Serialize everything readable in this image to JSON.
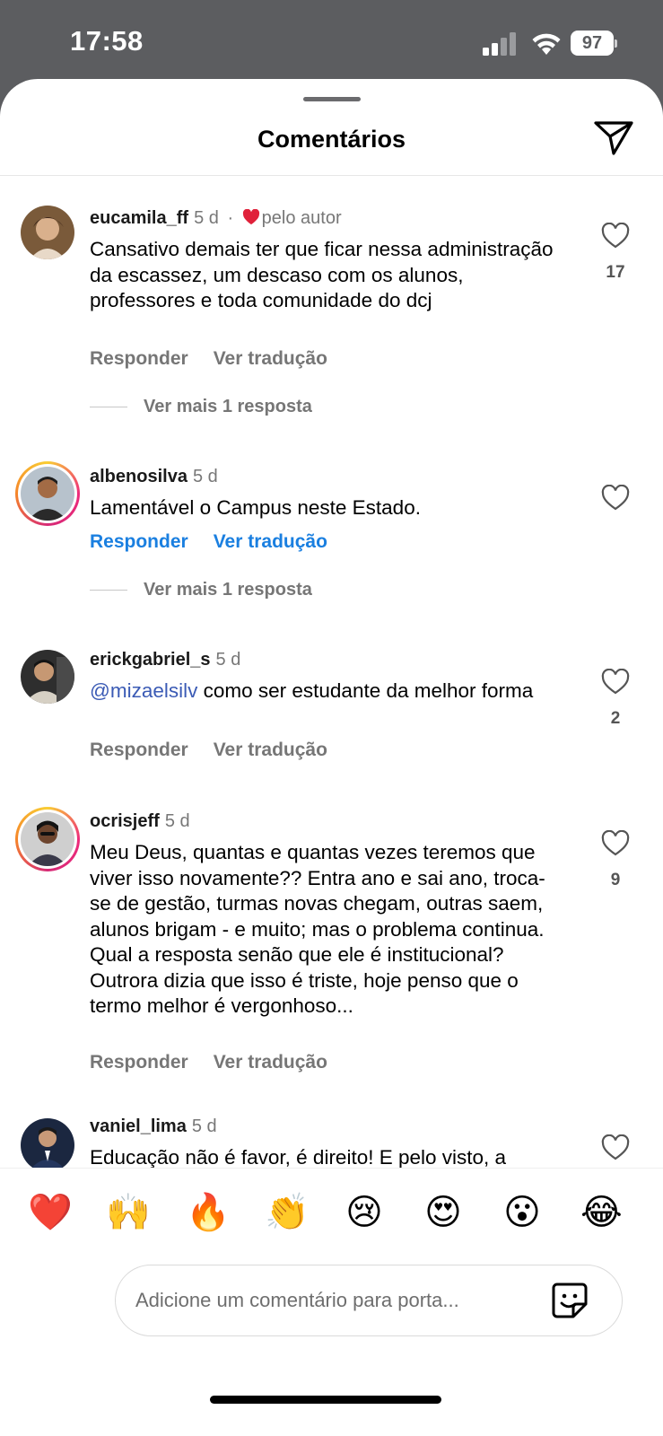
{
  "status": {
    "time": "17:58",
    "battery": "97"
  },
  "header": {
    "title": "Comentários"
  },
  "comments": [
    {
      "username": "eucamila_ff",
      "age": "5 d",
      "separator": "·",
      "liked_by_author": "pelo autor",
      "text": "Cansativo demais ter que ficar nessa administração da escassez, um descaso com os alunos, professores e toda comunidade do dcj",
      "reply": "Responder",
      "translate": "Ver tradução",
      "likes": "17",
      "more_replies": "Ver mais 1 resposta"
    },
    {
      "username": "albenosilva",
      "age": "5 d",
      "text": "Lamentável o Campus neste Estado.",
      "reply": "Responder",
      "translate": "Ver tradução",
      "likes": "",
      "more_replies": "Ver mais 1 resposta"
    },
    {
      "username": "erickgabriel_s",
      "age": "5 d",
      "mention": "@mizaelsilv",
      "text": " como ser estudante da melhor forma",
      "reply": "Responder",
      "translate": "Ver tradução",
      "likes": "2"
    },
    {
      "username": "ocrisjeff",
      "age": "5 d",
      "text": "Meu Deus, quantas e quantas vezes teremos que viver isso novamente?? Entra ano e sai ano, troca-se de gestão, turmas novas chegam, outras saem, alunos brigam - e muito; mas o problema continua. Qual a resposta senão que ele é institucional? Outrora dizia que isso é triste, hoje penso que o termo melhor é vergonhoso...",
      "reply": "Responder",
      "translate": "Ver tradução",
      "likes": "9"
    },
    {
      "username": "vaniel_lima",
      "age": "5 d",
      "text": "Educação não é favor, é direito! E pelo visto, a"
    }
  ],
  "reactions": [
    "❤️",
    "🙌",
    "🔥",
    "👏",
    "😢",
    "😍",
    "😮",
    "😂"
  ],
  "composer": {
    "placeholder": "Adicione um comentário para porta..."
  },
  "colors": {
    "accent_blue": "#1a7fe0",
    "mention_blue": "#3b5bb5",
    "heart_red": "#e0213a"
  }
}
